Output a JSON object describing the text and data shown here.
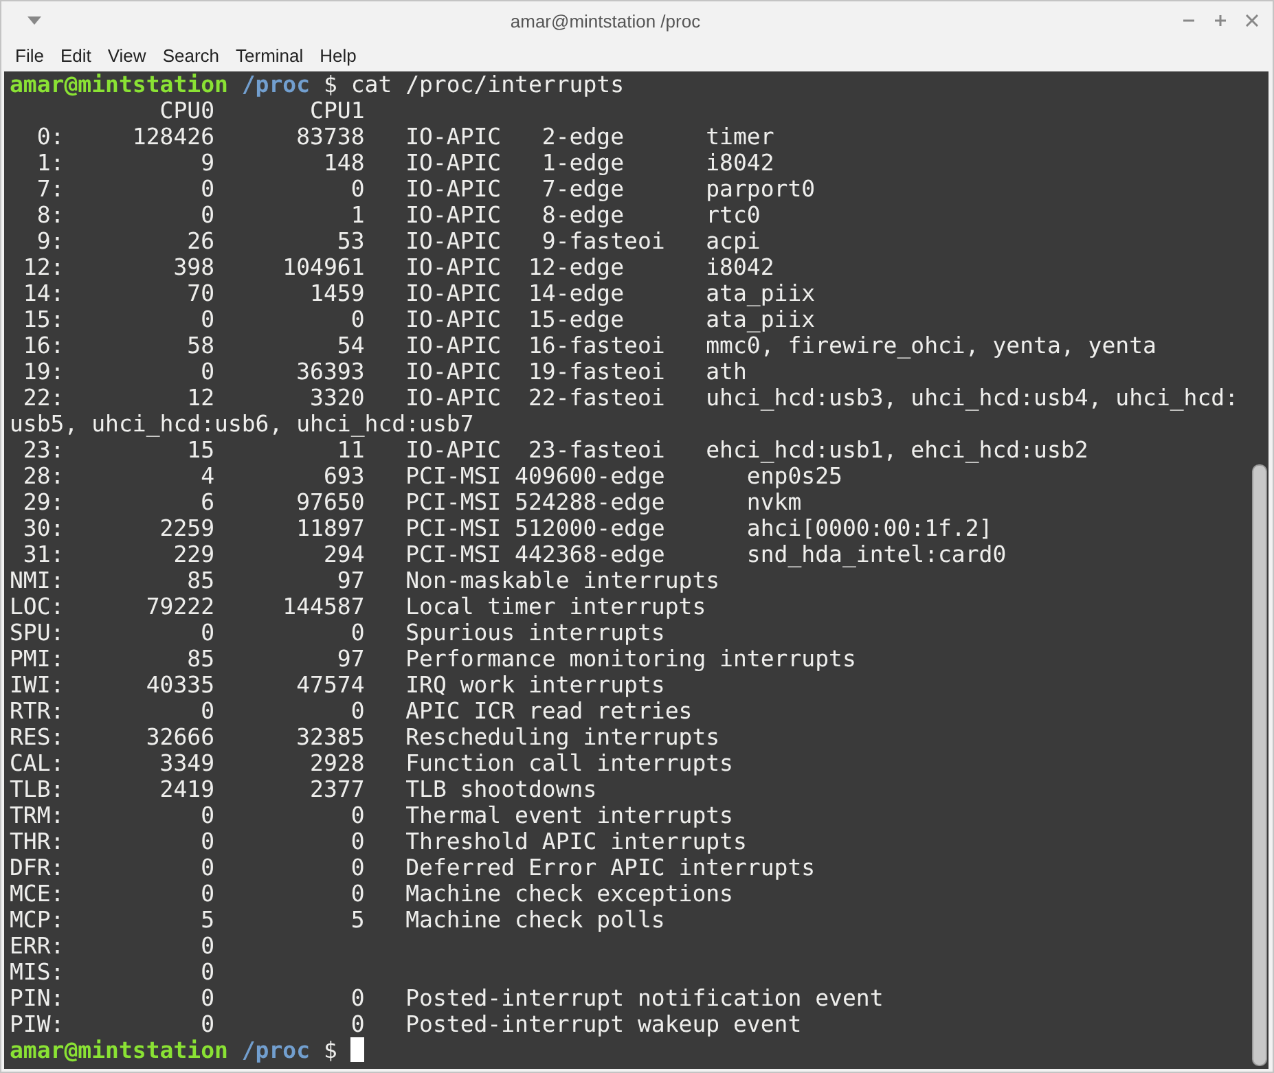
{
  "window": {
    "title": "amar@mintstation /proc"
  },
  "menu": [
    "File",
    "Edit",
    "View",
    "Search",
    "Terminal",
    "Help"
  ],
  "terminal": {
    "lines": [
      {
        "kind": "prompt",
        "user": "amar@mintstation",
        "path": "/proc",
        "symbol": "$",
        "command": "cat /proc/interrupts",
        "cursor": false
      },
      {
        "kind": "output",
        "text": "           CPU0       CPU1"
      },
      {
        "kind": "output",
        "text": "  0:     128426      83738   IO-APIC   2-edge      timer"
      },
      {
        "kind": "output",
        "text": "  1:          9        148   IO-APIC   1-edge      i8042"
      },
      {
        "kind": "output",
        "text": "  7:          0          0   IO-APIC   7-edge      parport0"
      },
      {
        "kind": "output",
        "text": "  8:          0          1   IO-APIC   8-edge      rtc0"
      },
      {
        "kind": "output",
        "text": "  9:         26         53   IO-APIC   9-fasteoi   acpi"
      },
      {
        "kind": "output",
        "text": " 12:        398     104961   IO-APIC  12-edge      i8042"
      },
      {
        "kind": "output",
        "text": " 14:         70       1459   IO-APIC  14-edge      ata_piix"
      },
      {
        "kind": "output",
        "text": " 15:          0          0   IO-APIC  15-edge      ata_piix"
      },
      {
        "kind": "output",
        "text": " 16:         58         54   IO-APIC  16-fasteoi   mmc0, firewire_ohci, yenta, yenta"
      },
      {
        "kind": "output",
        "text": " 19:          0      36393   IO-APIC  19-fasteoi   ath"
      },
      {
        "kind": "output",
        "text": " 22:         12       3320   IO-APIC  22-fasteoi   uhci_hcd:usb3, uhci_hcd:usb4, uhci_hcd:"
      },
      {
        "kind": "output",
        "text": "usb5, uhci_hcd:usb6, uhci_hcd:usb7"
      },
      {
        "kind": "output",
        "text": " 23:         15         11   IO-APIC  23-fasteoi   ehci_hcd:usb1, ehci_hcd:usb2"
      },
      {
        "kind": "output",
        "text": " 28:          4        693   PCI-MSI 409600-edge      enp0s25"
      },
      {
        "kind": "output",
        "text": " 29:          6      97650   PCI-MSI 524288-edge      nvkm"
      },
      {
        "kind": "output",
        "text": " 30:       2259      11897   PCI-MSI 512000-edge      ahci[0000:00:1f.2]"
      },
      {
        "kind": "output",
        "text": " 31:        229        294   PCI-MSI 442368-edge      snd_hda_intel:card0"
      },
      {
        "kind": "output",
        "text": "NMI:         85         97   Non-maskable interrupts"
      },
      {
        "kind": "output",
        "text": "LOC:      79222     144587   Local timer interrupts"
      },
      {
        "kind": "output",
        "text": "SPU:          0          0   Spurious interrupts"
      },
      {
        "kind": "output",
        "text": "PMI:         85         97   Performance monitoring interrupts"
      },
      {
        "kind": "output",
        "text": "IWI:      40335      47574   IRQ work interrupts"
      },
      {
        "kind": "output",
        "text": "RTR:          0          0   APIC ICR read retries"
      },
      {
        "kind": "output",
        "text": "RES:      32666      32385   Rescheduling interrupts"
      },
      {
        "kind": "output",
        "text": "CAL:       3349       2928   Function call interrupts"
      },
      {
        "kind": "output",
        "text": "TLB:       2419       2377   TLB shootdowns"
      },
      {
        "kind": "output",
        "text": "TRM:          0          0   Thermal event interrupts"
      },
      {
        "kind": "output",
        "text": "THR:          0          0   Threshold APIC interrupts"
      },
      {
        "kind": "output",
        "text": "DFR:          0          0   Deferred Error APIC interrupts"
      },
      {
        "kind": "output",
        "text": "MCE:          0          0   Machine check exceptions"
      },
      {
        "kind": "output",
        "text": "MCP:          5          5   Machine check polls"
      },
      {
        "kind": "output",
        "text": "ERR:          0"
      },
      {
        "kind": "output",
        "text": "MIS:          0"
      },
      {
        "kind": "output",
        "text": "PIN:          0          0   Posted-interrupt notification event"
      },
      {
        "kind": "output",
        "text": "PIW:          0          0   Posted-interrupt wakeup event"
      },
      {
        "kind": "prompt",
        "user": "amar@mintstation",
        "path": "/proc",
        "symbol": "$",
        "cursor": true
      }
    ]
  }
}
